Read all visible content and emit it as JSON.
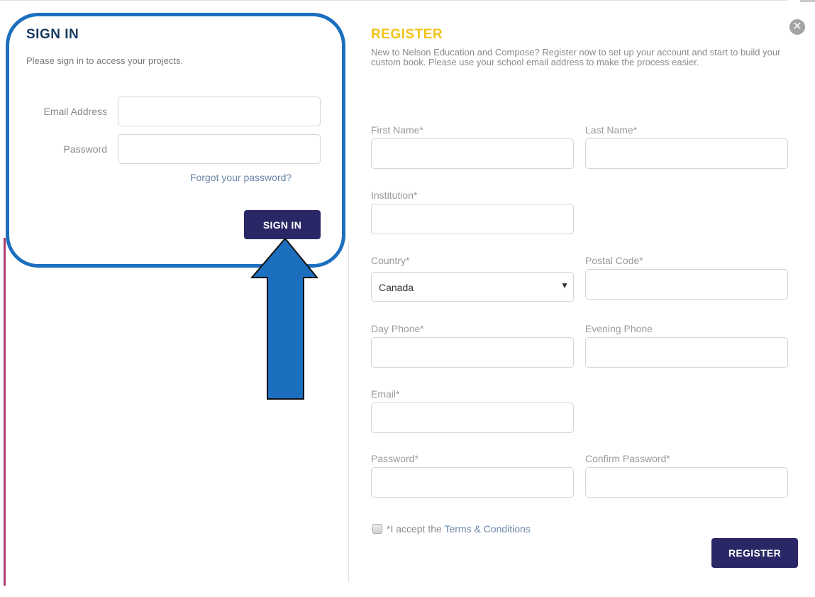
{
  "signin": {
    "title": "SIGN IN",
    "subtitle": "Please sign in to access your projects.",
    "email_label": "Email Address",
    "password_label": "Password",
    "email_value": "",
    "password_value": "",
    "forgot_link": "Forgot your password?",
    "button": "SIGN IN"
  },
  "register": {
    "title": "REGISTER",
    "description": "New to Nelson Education and Compose? Register now to set up your account and start to build your custom book. Please use your school email address to make the process easier.",
    "fields": {
      "first_name": "First Name*",
      "last_name": "Last Name*",
      "institution": "Institution*",
      "country": "Country*",
      "postal_code": "Postal Code*",
      "day_phone": "Day Phone*",
      "evening_phone": "Evening Phone",
      "email": "Email*",
      "password": "Password*",
      "confirm_password": "Confirm Password*"
    },
    "country_value": "Canada",
    "accept_prefix": "*I accept the ",
    "terms_link": "Terms & Conditions",
    "button": "REGISTER"
  },
  "icons": {
    "close": "close-icon",
    "dropdown": "chevron-down-icon"
  },
  "colors": {
    "signin_title": "#173a5e",
    "register_title": "#f2c21a",
    "button_bg": "#2a2766",
    "link": "#6a86a8",
    "annotation": "#1c6fbe"
  }
}
